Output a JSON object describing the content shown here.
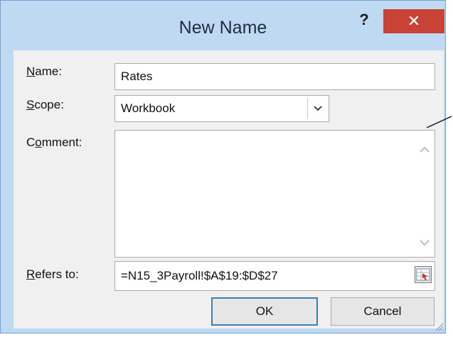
{
  "dialog": {
    "title": "New Name",
    "help_label": "?",
    "close_label": "✕"
  },
  "form": {
    "name_label_ul": "N",
    "name_label_rest": "ame:",
    "name_value": "Rates",
    "scope_label_ul": "S",
    "scope_label_rest": "cope:",
    "scope_value": "Workbook",
    "comment_label_pre": "C",
    "comment_label_ul": "o",
    "comment_label_rest": "mment:",
    "comment_value": "",
    "refers_label_ul": "R",
    "refers_label_rest": "efers to:",
    "refers_value": "=N15_3Payroll!$A$19:$D$27"
  },
  "buttons": {
    "ok_label": "OK",
    "cancel_label": "Cancel"
  },
  "icons": {
    "help": "question-mark-icon",
    "close": "close-icon",
    "scope_dropdown": "chevron-down-icon",
    "scroll_up": "chevron-up-icon",
    "scroll_down": "chevron-down-icon",
    "collapse": "range-collapse-icon",
    "resize": "resize-grip-icon"
  },
  "colors": {
    "frame": "#bfd9f2",
    "close_button": "#c84235",
    "ok_border": "#3c7fb1"
  }
}
